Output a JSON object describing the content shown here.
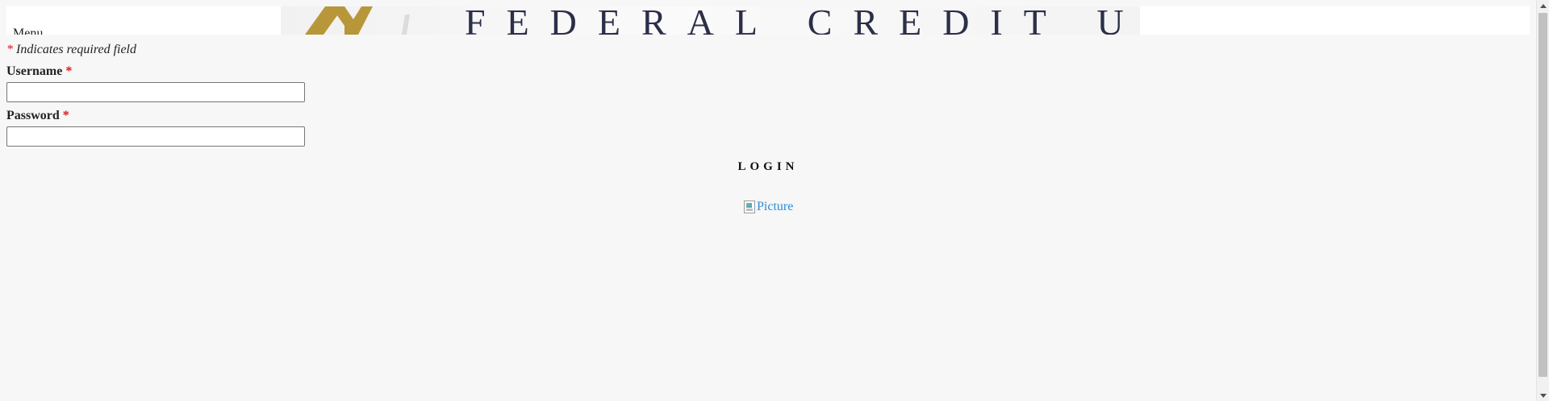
{
  "banner": {
    "title": "FEDERAL CREDIT UNION",
    "menu_label": "Menu",
    "logo_colors": [
      "#b8973a",
      "#2c2f48"
    ]
  },
  "form": {
    "required_star": "*",
    "required_note": "Indicates required field",
    "username_label": "Username",
    "username_value": "",
    "password_label": "Password",
    "password_value": "",
    "login_label": "LOGIN"
  },
  "footer": {
    "picture_alt": "Picture",
    "link_color": "#2a8dd4"
  },
  "colors": {
    "background": "#f7f7f7",
    "required": "#d9141c"
  },
  "scrollbar": {
    "up_icon": "triangle-up-icon",
    "down_icon": "triangle-down-icon"
  }
}
